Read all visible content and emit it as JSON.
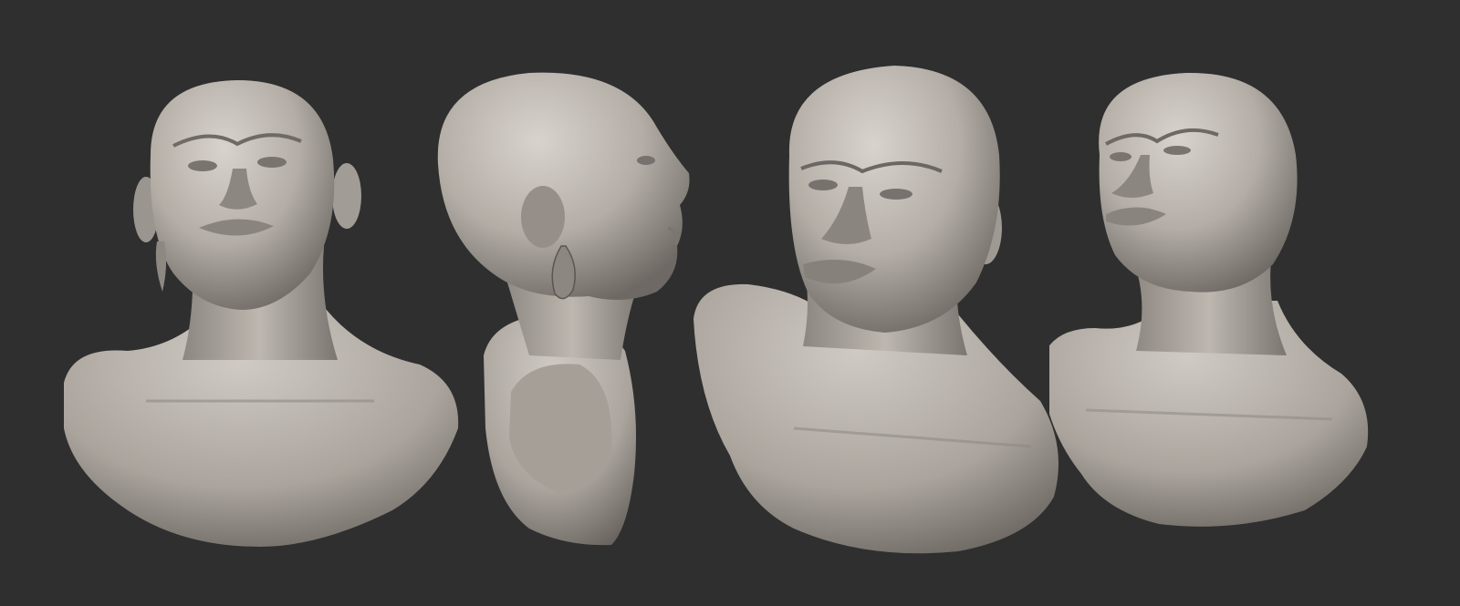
{
  "scene": {
    "background_color": "#2f2f2f",
    "clay_color": "#b7b1aa",
    "clay_highlight": "#d3cec7",
    "clay_shadow": "#6c6762",
    "busts": [
      {
        "id": "bust-1",
        "view": "front-low-angle",
        "earring": true
      },
      {
        "id": "bust-2",
        "view": "right-profile",
        "earring": true
      },
      {
        "id": "bust-3",
        "view": "three-quarter-left",
        "earring": false
      },
      {
        "id": "bust-4",
        "view": "three-quarter-right-low-angle",
        "earring": false
      }
    ]
  }
}
